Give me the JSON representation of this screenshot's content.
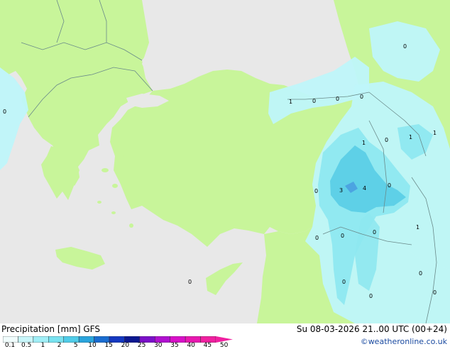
{
  "map": {
    "colors": {
      "sea": "#e8e8e8",
      "land": "#c8f59a",
      "precip_light": "#bff6fa",
      "precip_mid": "#8ee8f0",
      "precip_heavy": "#5ccfe6",
      "precip_core": "#4a9ee0",
      "border": "#6a8a8a"
    },
    "contour_labels": [
      "1",
      "0",
      "0",
      "0",
      "0",
      "1",
      "0",
      "1",
      "1",
      "0",
      "3",
      "4",
      "0",
      "0",
      "0",
      "1",
      "0",
      "0",
      "0",
      "0",
      "0",
      "0",
      "0"
    ]
  },
  "legend": {
    "title": "Precipitation [mm]  GFS",
    "ticks": [
      "0.1",
      "0.5",
      "1",
      "2",
      "5",
      "10",
      "15",
      "20",
      "25",
      "30",
      "35",
      "40",
      "45",
      "50"
    ],
    "colors": [
      "#f0fcfc",
      "#c8f6fa",
      "#a0eef6",
      "#78e2f0",
      "#50cce8",
      "#2aa4dc",
      "#1a6cd0",
      "#1438c0",
      "#0c1890",
      "#7a10c8",
      "#b010d0",
      "#d810c8",
      "#e818b0",
      "#f020a0"
    ]
  },
  "header": {
    "valid_time": "Su 08-03-2026 21..00 UTC (00+24)",
    "credit": "©weatheronline.co.uk"
  }
}
